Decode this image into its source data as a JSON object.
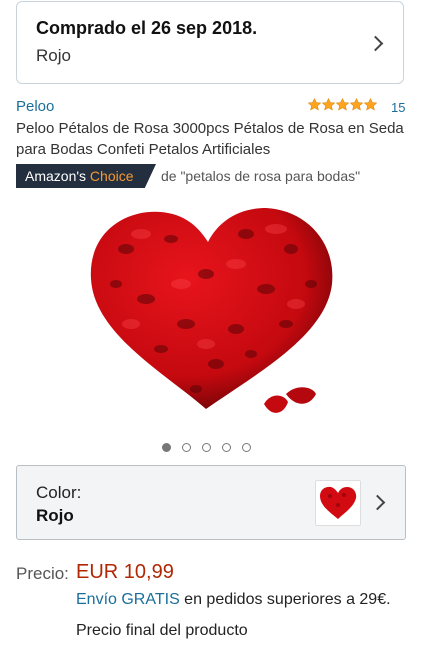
{
  "order": {
    "title": "Comprado el 26 sep 2018.",
    "subtitle": "Rojo"
  },
  "product": {
    "brand": "Peloo",
    "rating": 5,
    "rating_count": "15",
    "title": "Peloo Pétalos de Rosa 3000pcs Pétalos de Rosa en Seda para Bodas Confeti Petalos Artificiales",
    "badge": {
      "prefix": "Amazon's",
      "highlight": "Choice",
      "for_text": "de \"petalos de rosa para bodas\""
    },
    "image_icon": "heart-rose-petals-image",
    "gallery": {
      "count": 5,
      "active_index": 1
    }
  },
  "variant": {
    "label": "Color:",
    "value": "Rojo"
  },
  "price": {
    "label": "Precio:",
    "value": "EUR 10,99",
    "shipping_link": "Envío GRATIS",
    "shipping_rest": " en pedidos superiores a 29€.",
    "final_note": "Precio final del producto"
  },
  "colors": {
    "link": "#1a6f9a",
    "price": "#b12704",
    "badge_bg": "#232f3e",
    "badge_highlight": "#f69931",
    "star": "#ffa41c"
  }
}
